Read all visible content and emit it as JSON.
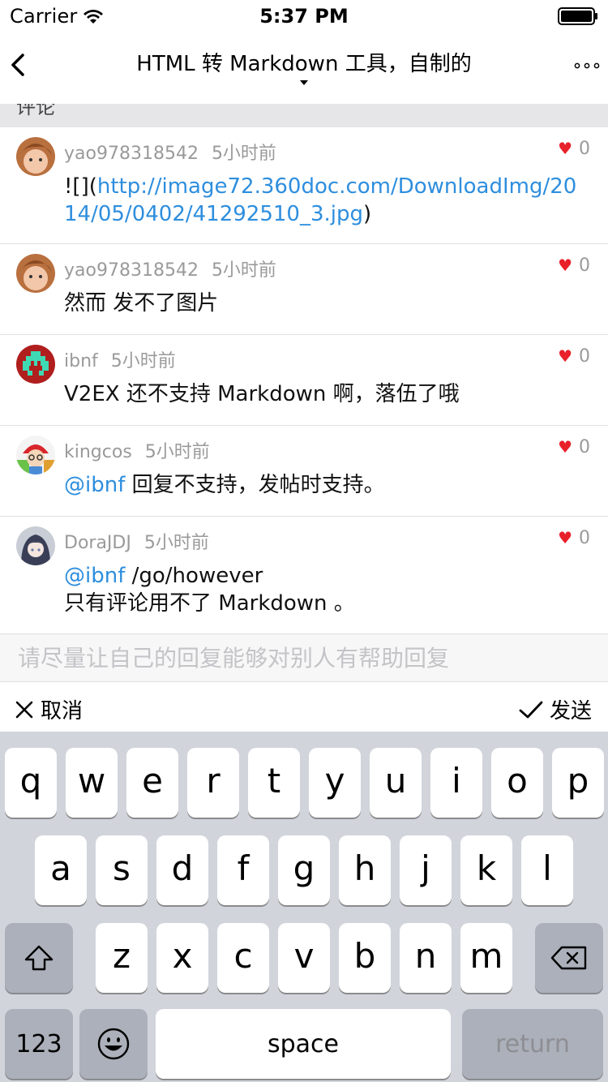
{
  "status_bar": {
    "carrier": "Carrier",
    "time": "5:37 PM"
  },
  "nav": {
    "title": "HTML 转 Markdown 工具，自制的"
  },
  "section": {
    "header": "评论"
  },
  "comments": [
    {
      "user": "yao978318542",
      "time": "5小时前",
      "likes": "0",
      "prefix": "![](",
      "link": "http://image72.360doc.com/DownloadImg/2014/05/0402/41292510_3.jpg",
      "suffix": ")"
    },
    {
      "user": "yao978318542",
      "time": "5小时前",
      "likes": "0",
      "text": "然而 发不了图片"
    },
    {
      "user": "ibnf",
      "time": "5小时前",
      "likes": "0",
      "text": "V2EX 还不支持 Markdown 啊，落伍了哦"
    },
    {
      "user": "kingcos",
      "time": "5小时前",
      "likes": "0",
      "at": "@",
      "mention": "ibnf",
      "text": " 回复不支持，发帖时支持。"
    },
    {
      "user": "DoraJDJ",
      "time": "5小时前",
      "likes": "0",
      "at": "@",
      "mention": "ibnf",
      "text": " /go/however",
      "line2": "只有评论用不了 Markdown 。"
    }
  ],
  "reply": {
    "placeholder": "请尽量让自己的回复能够对别人有帮助回复",
    "value": ""
  },
  "actions": {
    "cancel": "取消",
    "send": "发送"
  },
  "keyboard": {
    "row1": [
      "q",
      "w",
      "e",
      "r",
      "t",
      "y",
      "u",
      "i",
      "o",
      "p"
    ],
    "row2": [
      "a",
      "s",
      "d",
      "f",
      "g",
      "h",
      "j",
      "k",
      "l"
    ],
    "row3": [
      "z",
      "x",
      "c",
      "v",
      "b",
      "n",
      "m"
    ],
    "numbers": "123",
    "space": "space",
    "return": "return"
  },
  "icons": {
    "back": "chevron-left-icon",
    "more": "ellipsis-icon",
    "heart": "heart-icon",
    "cancel": "close-icon",
    "send": "checkmark-icon",
    "shift": "shift-icon",
    "delete": "delete-icon",
    "emoji": "emoji-icon"
  },
  "colors": {
    "link": "#2e8ede",
    "heart": "#e8202a",
    "keyboard_bg": "#d1d5db"
  }
}
